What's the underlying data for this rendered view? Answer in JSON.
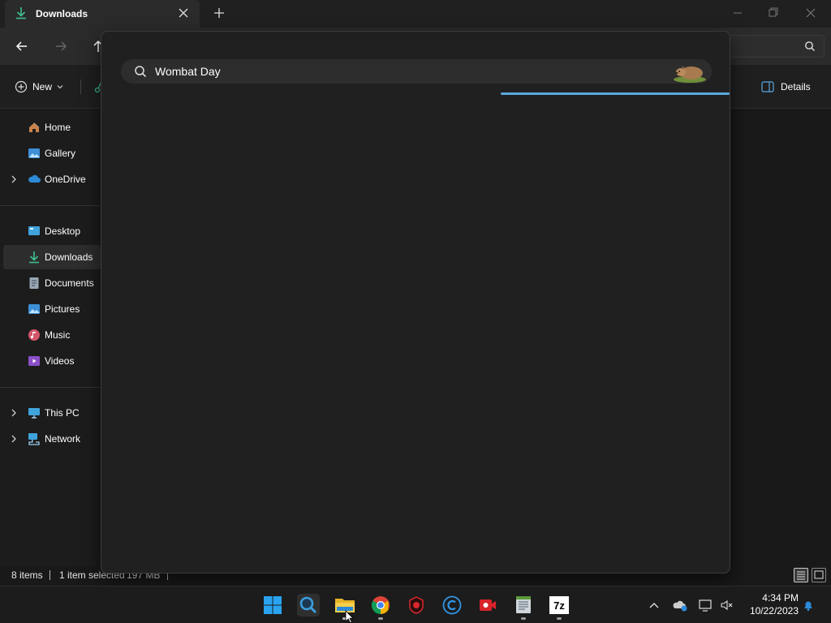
{
  "window": {
    "tab_title": "Downloads",
    "icons": {
      "tab": "download-icon",
      "close_tab": "close-icon",
      "new_tab": "plus-icon"
    }
  },
  "toolbar": {
    "new_label": "New",
    "details_label": "Details"
  },
  "sidebar": {
    "items": [
      {
        "label": "Home",
        "icon": "home-icon",
        "expandable": false
      },
      {
        "label": "Gallery",
        "icon": "gallery-icon",
        "expandable": false
      },
      {
        "label": "OneDrive",
        "icon": "cloud-icon",
        "expandable": true
      },
      {
        "label": "Desktop",
        "icon": "desktop-icon",
        "expandable": false
      },
      {
        "label": "Downloads",
        "icon": "download-icon",
        "expandable": false,
        "selected": true
      },
      {
        "label": "Documents",
        "icon": "document-icon",
        "expandable": false
      },
      {
        "label": "Pictures",
        "icon": "pictures-icon",
        "expandable": false
      },
      {
        "label": "Music",
        "icon": "music-icon",
        "expandable": false
      },
      {
        "label": "Videos",
        "icon": "videos-icon",
        "expandable": false
      },
      {
        "label": "This PC",
        "icon": "computer-icon",
        "expandable": true
      },
      {
        "label": "Network",
        "icon": "network-icon",
        "expandable": true
      }
    ]
  },
  "status": {
    "item_count": "8 items",
    "selection": "1 item selected",
    "size": "197 MB"
  },
  "search_popup": {
    "query": "Wombat Day",
    "progress_loading": true
  },
  "taskbar": {
    "apps": [
      "windows-start-icon",
      "search-app-icon",
      "file-explorer-icon",
      "chrome-icon",
      "red-app-icon",
      "ccleaner-icon",
      "recorder-icon",
      "notepad-icon",
      "7zip-icon"
    ],
    "zip_label": "7z",
    "time": "4:34 PM",
    "date": "10/22/2023"
  },
  "colors": {
    "accent": "#5aa8e0",
    "download_green": "#3fbf8f"
  }
}
